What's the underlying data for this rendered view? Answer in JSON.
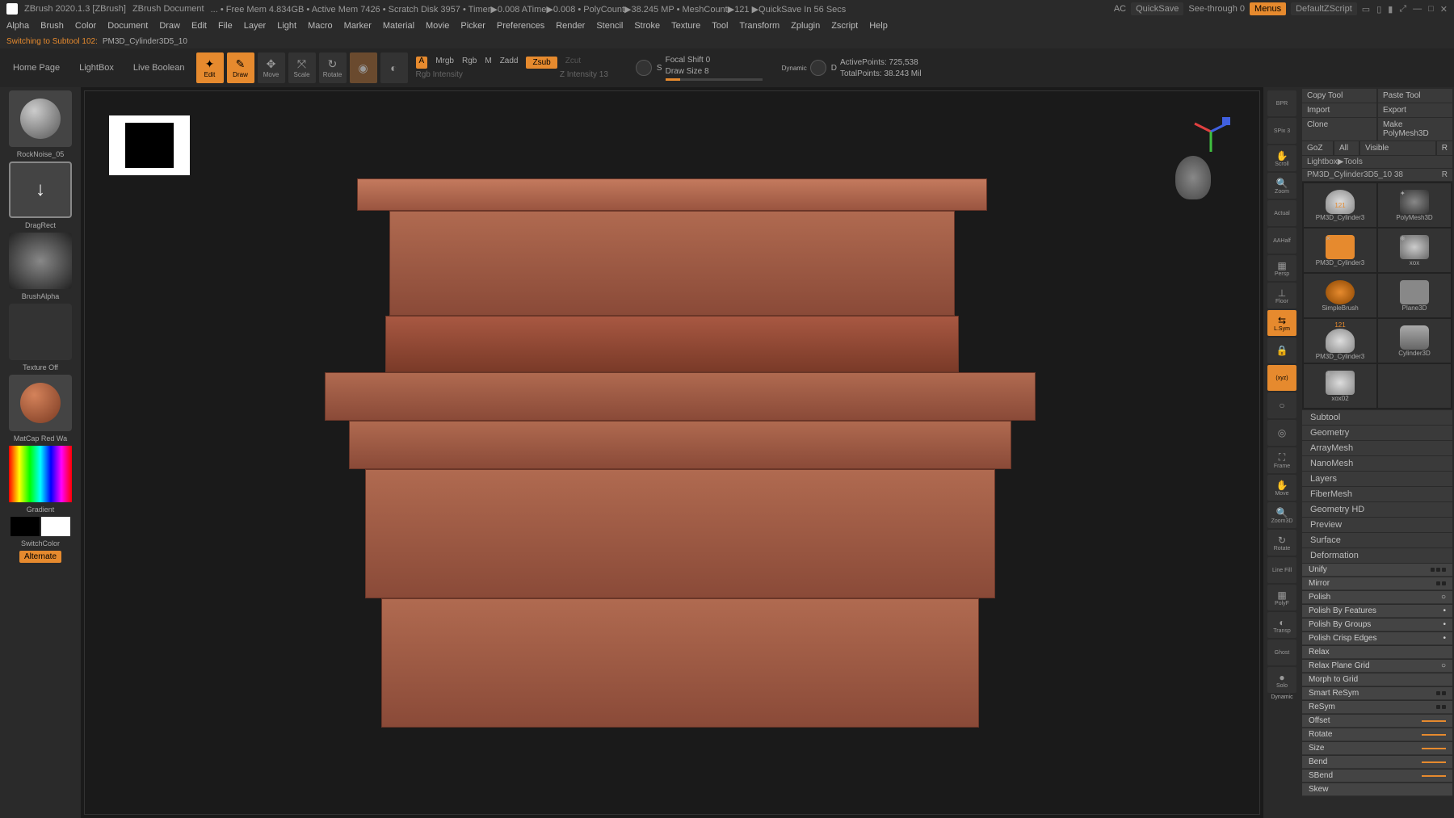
{
  "titlebar": {
    "app": "ZBrush 2020.1.3 [ZBrush]",
    "doc": "ZBrush Document",
    "stats": "... • Free Mem 4.834GB • Active Mem 7426 • Scratch Disk 3957 • Timer▶0.008 ATime▶0.008 • PolyCount▶38.245 MP • MeshCount▶121 ▶QuickSave In 56 Secs",
    "ac": "AC",
    "quicksave": "QuickSave",
    "seethrough": "See-through  0",
    "menus": "Menus",
    "defaultscript": "DefaultZScript"
  },
  "menubar": [
    "Alpha",
    "Brush",
    "Color",
    "Document",
    "Draw",
    "Edit",
    "File",
    "Layer",
    "Light",
    "Macro",
    "Marker",
    "Material",
    "Movie",
    "Picker",
    "Preferences",
    "Render",
    "Stencil",
    "Stroke",
    "Texture",
    "Tool",
    "Transform",
    "Zplugin",
    "Zscript",
    "Help"
  ],
  "statusline": {
    "msg": "Switching to Subtool 102:",
    "name": "PM3D_Cylinder3D5_10"
  },
  "toolbar": {
    "homepage": "Home Page",
    "lightbox": "LightBox",
    "liveboolean": "Live Boolean",
    "edit": "Edit",
    "draw": "Draw",
    "move": "Move",
    "scale": "Scale",
    "rotate": "Rotate",
    "a": "A",
    "mrgb": "Mrgb",
    "rgb": "Rgb",
    "m": "M",
    "zadd": "Zadd",
    "zsub": "Zsub",
    "zcut": "Zcut",
    "rgbintensity": "Rgb Intensity",
    "zintensity": "Z Intensity 13",
    "focalshift": "Focal Shift 0",
    "drawsize": "Draw Size 8",
    "dynamic": "Dynamic",
    "activepoints": "ActivePoints: 725,538",
    "totalpoints": "TotalPoints: 38.243 Mil"
  },
  "leftbar": {
    "brush": "RockNoise_05",
    "stroke": "DragRect",
    "alpha": "BrushAlpha",
    "texture": "Texture Off",
    "material": "MatCap Red Wa",
    "gradient": "Gradient",
    "switchcolor": "SwitchColor",
    "alternate": "Alternate"
  },
  "rightbar": {
    "bpr": "BPR",
    "spix": "SPix 3",
    "scroll": "Scroll",
    "zoom": "Zoom",
    "actual": "Actual",
    "aahalf": "AAHalf",
    "persp": "Persp",
    "floor": "Floor",
    "lsym": "L.Sym",
    "lock": "",
    "xyz": "(xyz)",
    "frame": "Frame",
    "move": "Move",
    "zoom3d": "Zoom3D",
    "rotate": "Rotate",
    "linefill": "Line Fill",
    "polyf": "PolyF",
    "transp": "Transp",
    "ghost": "Ghost",
    "solo": "Solo",
    "dynamic": "Dynamic"
  },
  "panel": {
    "copytool": "Copy Tool",
    "pastetool": "Paste Tool",
    "import": "Import",
    "export": "Export",
    "clone": "Clone",
    "makepoly": "Make PolyMesh3D",
    "goz": "GoZ",
    "all": "All",
    "visible": "Visible",
    "r": "R",
    "lightbox": "Lightbox▶Tools",
    "currenttool": "PM3D_Cylinder3D5_10  38",
    "toolr": "R",
    "count121": "121",
    "count121b": "121",
    "tools": [
      "PM3D_Cylinder3",
      "PolyMesh3D",
      "PM3D_Cylinder3",
      "xox",
      "SimpleBrush",
      "Plane3D",
      "PM3D_Cylinder3",
      "Cylinder3D",
      "xox02",
      ""
    ],
    "sections": [
      "Subtool",
      "Geometry",
      "ArrayMesh",
      "NanoMesh",
      "Layers",
      "FiberMesh",
      "Geometry HD",
      "Preview",
      "Surface",
      "Deformation"
    ],
    "deform": [
      "Unify",
      "Mirror",
      "Polish",
      "Polish By Features",
      "Polish By Groups",
      "Polish Crisp Edges",
      "Relax",
      "Relax Plane Grid",
      "Morph to Grid",
      "Smart ReSym",
      "ReSym",
      "Offset",
      "Rotate",
      "Size",
      "Bend",
      "SBend",
      "Skew"
    ]
  }
}
